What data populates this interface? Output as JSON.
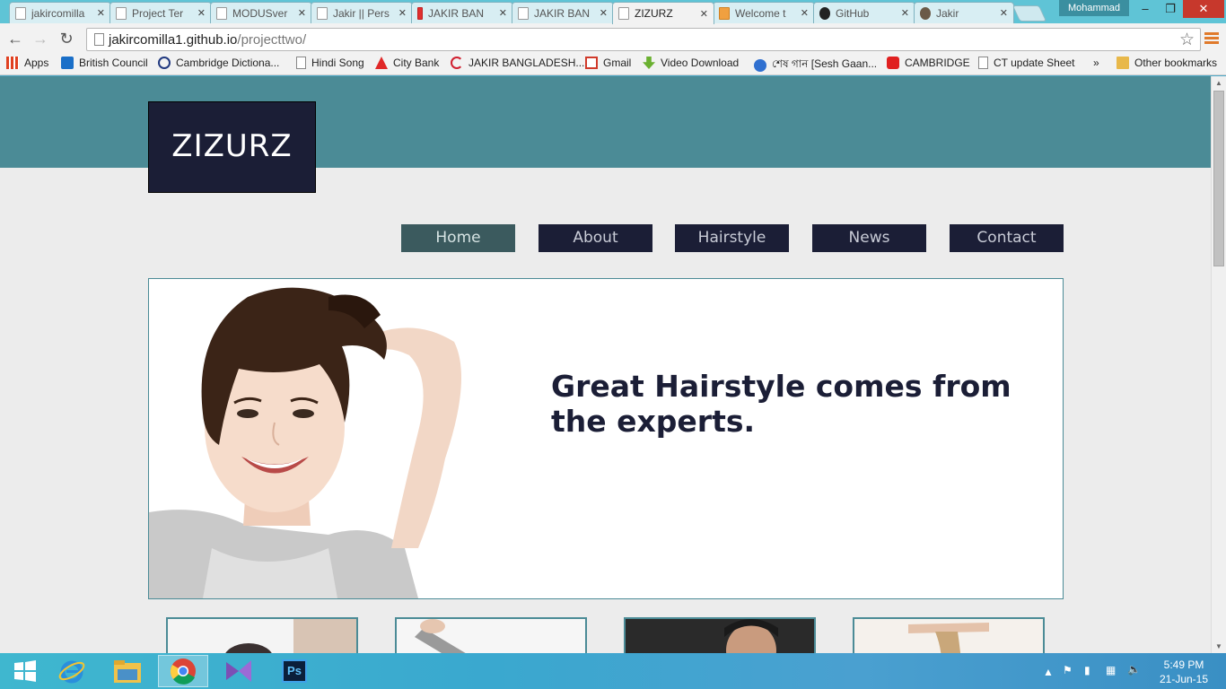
{
  "browser": {
    "tabs": [
      {
        "title": "jakircomilla",
        "icon": "page-icon"
      },
      {
        "title": "Project Ter",
        "icon": "page-icon"
      },
      {
        "title": "MODUSver",
        "icon": "page-icon"
      },
      {
        "title": "Jakir || Pers",
        "icon": "page-icon"
      },
      {
        "title": "JAKIR BAN",
        "icon": "jakir-icon"
      },
      {
        "title": "JAKIR BAN",
        "icon": "page-icon"
      },
      {
        "title": "ZIZURZ",
        "icon": "page-icon"
      },
      {
        "title": "Welcome t",
        "icon": "welcome-icon"
      },
      {
        "title": "GitHub",
        "icon": "github-icon"
      },
      {
        "title": "Jakir",
        "icon": "avatar-icon"
      }
    ],
    "active_tab": 6,
    "profile_name": "Mohammad",
    "url_host": "jakircomilla1.github.io",
    "url_path": "/projecttwo/",
    "bookmarks": [
      {
        "label": "Apps",
        "icon": "apps-icon"
      },
      {
        "label": "British Council",
        "icon": "british-council-icon"
      },
      {
        "label": "Cambridge Dictiona...",
        "icon": "cambridge-icon"
      },
      {
        "label": "Hindi Song",
        "icon": "page-icon"
      },
      {
        "label": "City Bank",
        "icon": "city-bank-icon"
      },
      {
        "label": "JAKIR BANGLADESH...",
        "icon": "jakir-icon"
      },
      {
        "label": "Gmail",
        "icon": "gmail-icon"
      },
      {
        "label": "Video Download",
        "icon": "download-icon"
      },
      {
        "label": "শেষ গান [Sesh Gaan...",
        "icon": "music-icon"
      },
      {
        "label": "CAMBRIDGE",
        "icon": "youtube-icon"
      },
      {
        "label": "CT update Sheet",
        "icon": "page-icon"
      }
    ],
    "bookmarks_overflow": "»",
    "other_bookmarks": "Other bookmarks"
  },
  "site": {
    "logo": "ZIZURZ",
    "nav": [
      {
        "label": "Home",
        "active": true
      },
      {
        "label": "About",
        "active": false
      },
      {
        "label": "Hairstyle",
        "active": false
      },
      {
        "label": "News",
        "active": false
      },
      {
        "label": "Contact",
        "active": false
      }
    ],
    "hero_heading": "Great Hairstyle comes from the experts."
  },
  "taskbar": {
    "time": "5:49 PM",
    "date": "21-Jun-15",
    "apps": [
      "ie-icon",
      "file-explorer-icon",
      "chrome-icon",
      "visual-studio-icon",
      "photoshop-icon"
    ],
    "photoshop_label": "Ps"
  },
  "colors": {
    "header": "#4b8b96",
    "logo_bg": "#1b1e36",
    "nav_bg": "#1b1e36",
    "nav_active": "#3b5a5e",
    "heading": "#1b1e36",
    "page_bg": "#ececec"
  }
}
